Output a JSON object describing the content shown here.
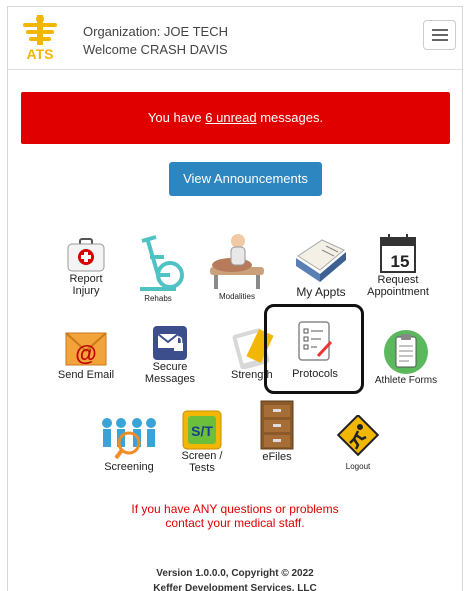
{
  "header": {
    "org_line": "Organization: JOE TECH",
    "welcome_line": "Welcome CRASH DAVIS",
    "logo_text": "ATS"
  },
  "alert": {
    "prefix": "You have ",
    "link": "6 unread",
    "suffix": " messages."
  },
  "announcements_button": "View Announcements",
  "tiles": {
    "report_injury": [
      "Report",
      "Injury"
    ],
    "rehabs": "Rehabs",
    "modalities": "Modalities",
    "my_appts": "My Appts",
    "request_appointment": [
      "Request",
      "Appointment"
    ],
    "send_email": "Send Email",
    "secure_messages": [
      "Secure",
      "Messages"
    ],
    "strength": "Strength",
    "protocols": "Protocols",
    "athlete_forms": "Athlete Forms",
    "screening": "Screening",
    "screen_tests": [
      "Screen /",
      "Tests"
    ],
    "efiles": "eFiles",
    "logout": "Logout"
  },
  "calendar_day": "15",
  "screen_tests_badge": "S/T",
  "question": [
    "If you have ANY questions or problems",
    "contact your medical staff."
  ],
  "footer": [
    "Version 1.0.0.0, Copyright © 2022",
    "Keffer Development Services, LLC"
  ]
}
